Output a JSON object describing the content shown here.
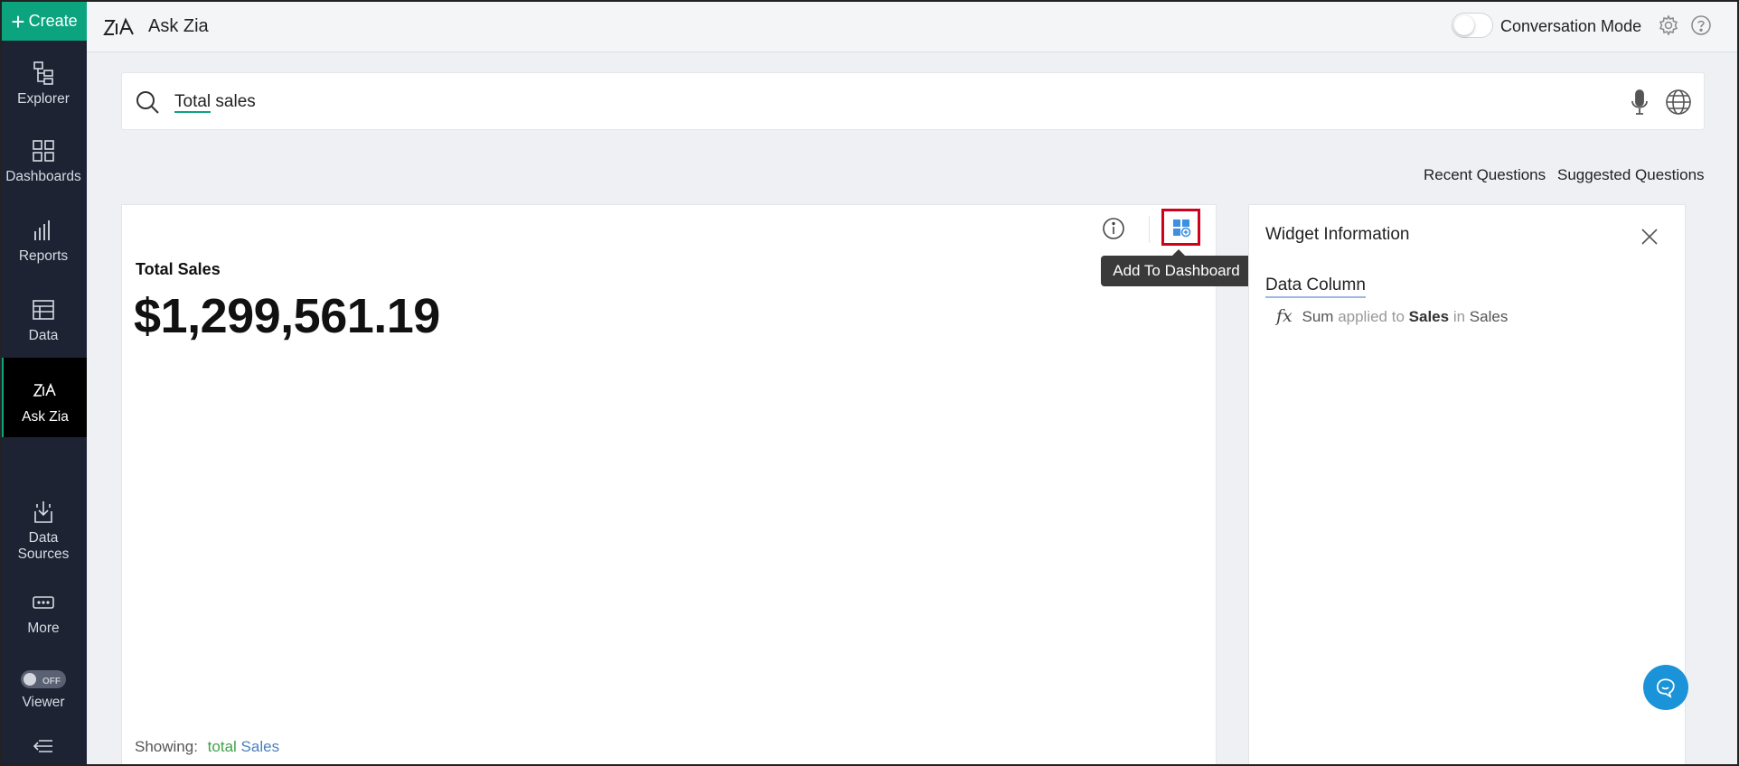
{
  "sidebar": {
    "create_label": "Create",
    "items": [
      {
        "label": "Explorer",
        "icon": "explorer-icon"
      },
      {
        "label": "Dashboards",
        "icon": "dashboards-icon"
      },
      {
        "label": "Reports",
        "icon": "reports-icon"
      },
      {
        "label": "Data",
        "icon": "data-icon"
      },
      {
        "label": "Ask Zia",
        "icon": "zia-icon",
        "active": true
      },
      {
        "label": "Data Sources",
        "icon": "data-sources-icon"
      },
      {
        "label": "More",
        "icon": "more-icon"
      },
      {
        "label": "Viewer",
        "icon": "toggle"
      }
    ],
    "viewer_toggle_state": "OFF",
    "collapse_icon": "collapse-icon"
  },
  "header": {
    "title": "Ask Zia",
    "conversation_mode_label": "Conversation Mode",
    "conversation_mode_on": false
  },
  "search": {
    "query_underlined": "Total",
    "query_rest": " sales"
  },
  "links": {
    "recent": "Recent Questions",
    "suggested": "Suggested Questions"
  },
  "result": {
    "tooltip": "Add To Dashboard",
    "kpi_label": "Total Sales",
    "kpi_value": "$1,299,561.19",
    "showing_label": "Showing:",
    "showing_word1": "total",
    "showing_word2": "Sales"
  },
  "widget_info": {
    "title": "Widget Information",
    "section": "Data Column",
    "fx": "fx",
    "f_sum": "Sum",
    "f_applied": "applied to",
    "f_col": "Sales",
    "f_in": "in",
    "f_table": "Sales"
  },
  "colors": {
    "brand_green": "#0ba47f",
    "sidebar_bg": "#1d2333",
    "chat_blue": "#1a93d8",
    "highlight_red": "#d0021b"
  }
}
